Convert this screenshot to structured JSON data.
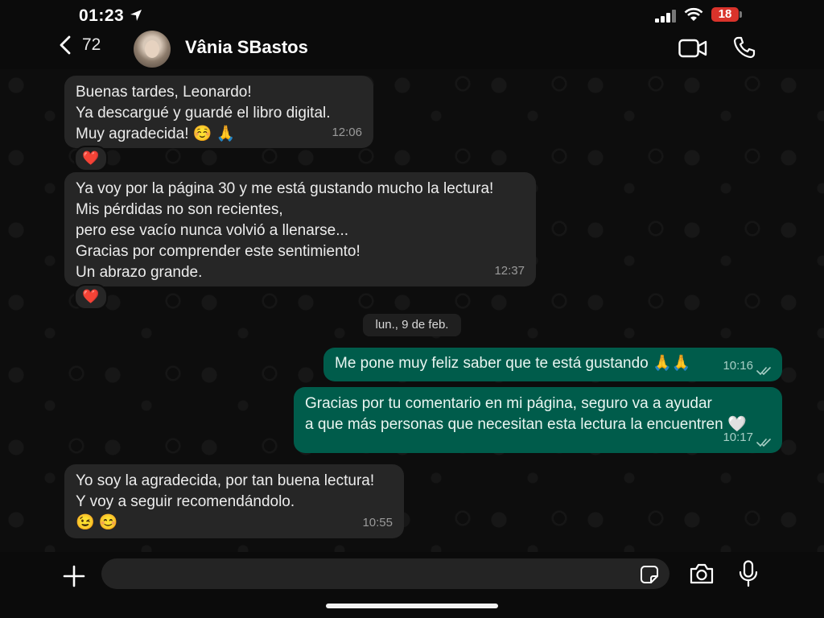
{
  "status_bar": {
    "time": "01:23",
    "battery": "18"
  },
  "header": {
    "back_count": "72",
    "contact_name": "Vânia SBastos"
  },
  "messages": [
    {
      "text": "Buenas tardes, Leonardo!\nYa descargué y guardé el libro digital.\nMuy agradecida! ☺️ 🙏",
      "time": "12:06",
      "reaction": "❤️"
    },
    {
      "text": "Ya voy por la página 30 y me está gustando mucho la lectura!\nMis pérdidas no son recientes,\npero ese vacío nunca volvió a llenarse...\nGracias por comprender este sentimiento!\nUn abrazo grande.",
      "time": "12:37",
      "reaction": "❤️"
    },
    {
      "text": "Me pone muy feliz saber que te está gustando 🙏🙏",
      "time": "10:16"
    },
    {
      "text": "Gracias por tu comentario en mi página, seguro va a ayudar\na que más personas que necesitan esta lectura la encuentren 🤍",
      "time": "10:17"
    },
    {
      "text": "Yo soy la agradecida, por tan buena lectura!\nY voy a seguir recomendándolo.\n😉 😊",
      "time": "10:55"
    }
  ],
  "date_separator": "lun., 9 de feb.",
  "composer": {
    "value": ""
  },
  "colors": {
    "incoming": "#262626",
    "outgoing": "#005c4b",
    "background": "#0b0b0b",
    "read_ticks": "#a9cfc6"
  },
  "icons": [
    "location-arrow-icon",
    "signal-icon",
    "wifi-icon",
    "battery-icon",
    "back-chevron-icon",
    "video-call-icon",
    "phone-icon",
    "double-check-icon",
    "plus-icon",
    "sticker-icon",
    "camera-icon",
    "mic-icon"
  ]
}
